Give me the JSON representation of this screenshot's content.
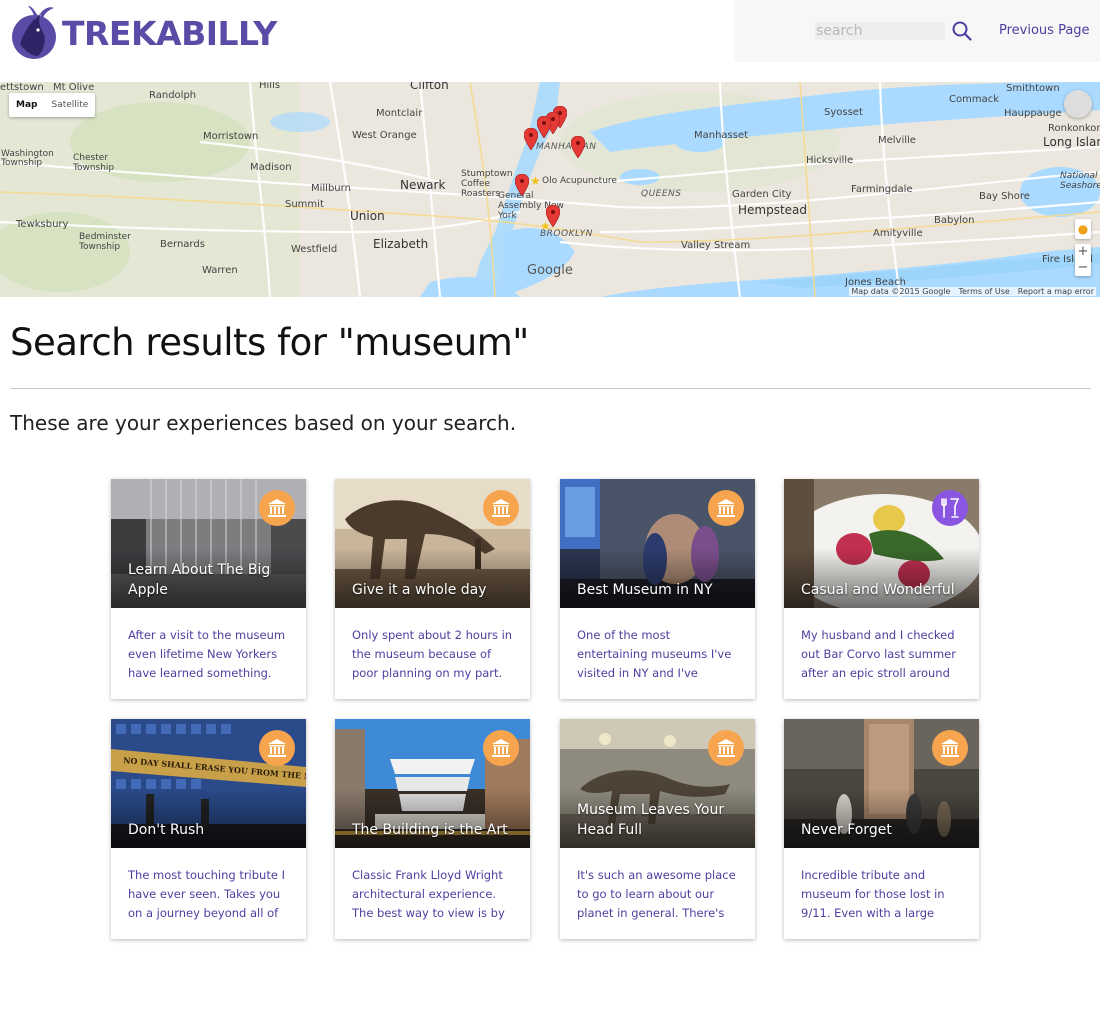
{
  "header": {
    "logo_text": "TREKABILLY",
    "search_placeholder": "search",
    "previous_page_label": "Previous Page"
  },
  "colors": {
    "brand_purple": "#5b4aa6",
    "link_purple": "#4d3fa0",
    "museum_badge": "#f6a54e",
    "food_badge": "#8a55e0"
  },
  "map": {
    "type_controls": [
      "Map",
      "Satellite"
    ],
    "places": [
      {
        "name": "Mt Olive",
        "style": "normal"
      },
      {
        "name": "Hills",
        "style": "normal"
      },
      {
        "name": "Clifton",
        "style": "big"
      },
      {
        "name": "Commack",
        "style": "normal"
      },
      {
        "name": "Smithtown",
        "style": "normal"
      },
      {
        "name": "Randolph",
        "style": "normal"
      },
      {
        "name": "Montclair",
        "style": "normal"
      },
      {
        "name": "Syosset",
        "style": "normal"
      },
      {
        "name": "Hauppauge",
        "style": "normal"
      },
      {
        "name": "Ronkonkoma",
        "style": "normal"
      },
      {
        "name": "Morristown",
        "style": "normal"
      },
      {
        "name": "West Orange",
        "style": "normal"
      },
      {
        "name": "MANHATTAN",
        "style": "italic"
      },
      {
        "name": "Manhasset",
        "style": "normal"
      },
      {
        "name": "Melville",
        "style": "normal"
      },
      {
        "name": "Long Island",
        "style": "big"
      },
      {
        "name": "Washington Township",
        "style": "normal"
      },
      {
        "name": "Chester Township",
        "style": "normal"
      },
      {
        "name": "Madison",
        "style": "normal"
      },
      {
        "name": "Stumptown Coffee Roasters",
        "style": "normal"
      },
      {
        "name": "Olo Acupuncture",
        "style": "normal"
      },
      {
        "name": "Hicksville",
        "style": "normal"
      },
      {
        "name": "Millburn",
        "style": "normal"
      },
      {
        "name": "Newark",
        "style": "big"
      },
      {
        "name": "QUEENS",
        "style": "italic"
      },
      {
        "name": "Farmingdale",
        "style": "normal"
      },
      {
        "name": "National Seashore",
        "style": "normal"
      },
      {
        "name": "Summit",
        "style": "normal"
      },
      {
        "name": "General Assembly New York",
        "style": "normal"
      },
      {
        "name": "Garden City",
        "style": "normal"
      },
      {
        "name": "Bay Shore",
        "style": "normal"
      },
      {
        "name": "Hempstead",
        "style": "big"
      },
      {
        "name": "Union",
        "style": "big"
      },
      {
        "name": "Babylon",
        "style": "normal"
      },
      {
        "name": "Tewksbury",
        "style": "normal"
      },
      {
        "name": "BROOKLYN",
        "style": "italic"
      },
      {
        "name": "Bedminster Township",
        "style": "normal"
      },
      {
        "name": "Bernards",
        "style": "normal"
      },
      {
        "name": "Westfield",
        "style": "normal"
      },
      {
        "name": "Elizabeth",
        "style": "big"
      },
      {
        "name": "Valley Stream",
        "style": "normal"
      },
      {
        "name": "Amityville",
        "style": "normal"
      },
      {
        "name": "Warren",
        "style": "normal"
      },
      {
        "name": "Fire Island",
        "style": "normal"
      },
      {
        "name": "Jones Beach",
        "style": "normal"
      },
      {
        "name": "ettstown",
        "style": "normal"
      }
    ],
    "google_mark": "Google",
    "attribution": [
      "Map data ©2015 Google",
      "Terms of Use",
      "Report a map error"
    ],
    "zoom_in": "+",
    "zoom_out": "−"
  },
  "main": {
    "title": "Search results for \"museum\"",
    "subtitle": "These are your experiences based on your search."
  },
  "cards": [
    {
      "title": "Learn About The Big Apple",
      "category_icon": "museum-icon",
      "text": "After a visit to the museum even lifetime New Yorkers have learned something."
    },
    {
      "title": "Give it a whole day",
      "category_icon": "museum-icon",
      "text": "Only spent about 2 hours in the museum because of poor planning on my part."
    },
    {
      "title": "Best Museum in NY",
      "category_icon": "museum-icon",
      "text": "One of the most entertaining museums I've visited in NY and I've"
    },
    {
      "title": "Casual and Wonderful",
      "category_icon": "food-drink-icon",
      "text": "My husband and I checked out Bar Corvo last summer after an epic stroll around"
    },
    {
      "title": "Don't Rush",
      "category_icon": "museum-icon",
      "text": "The most touching tribute I have ever seen. Takes you on a journey beyond all of",
      "image_caption": "NO DAY SHALL ERASE YOU FROM THE MEMORY OF TIME"
    },
    {
      "title": "The Building is the Art",
      "category_icon": "museum-icon",
      "text": "Classic Frank Lloyd Wright architectural experience. The best way to view is by"
    },
    {
      "title": "Museum Leaves Your Head Full",
      "category_icon": "museum-icon",
      "text": "It's such an awesome place to go to learn about our planet in general. There's"
    },
    {
      "title": "Never Forget",
      "category_icon": "museum-icon",
      "text": "Incredible tribute and museum for those lost in 9/11. Even with a large"
    }
  ]
}
